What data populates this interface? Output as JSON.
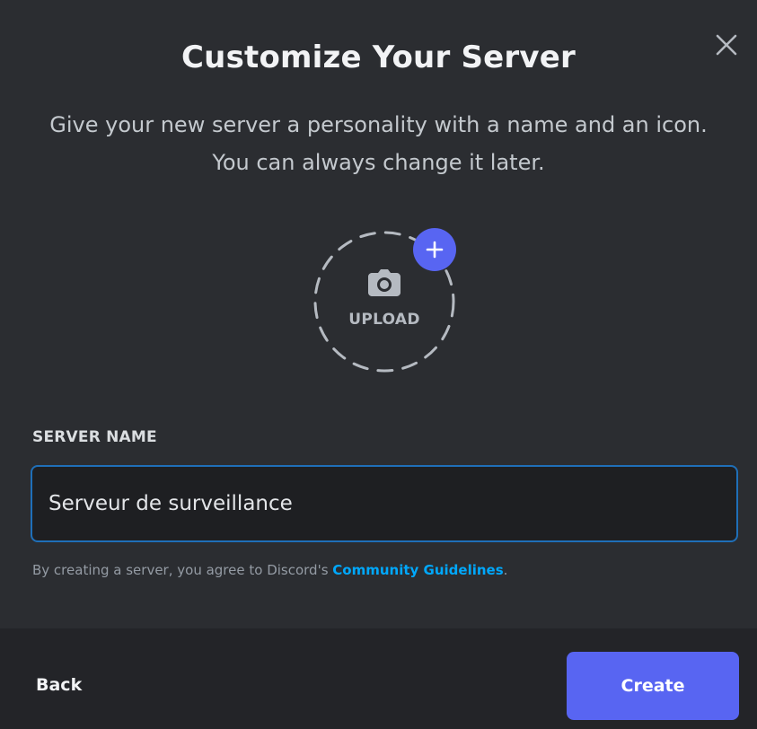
{
  "modal": {
    "title": "Customize Your Server",
    "subtitle": "Give your new server a personality with a name and an icon. You can always change it later.",
    "close_icon": "close-icon"
  },
  "upload": {
    "label": "UPLOAD",
    "camera_icon": "camera-icon",
    "plus_icon": "plus-icon"
  },
  "server_name": {
    "label": "SERVER NAME",
    "value": "Serveur de surveillance"
  },
  "agreement": {
    "prefix": "By creating a server, you agree to Discord's ",
    "link": "Community Guidelines",
    "suffix": "."
  },
  "footer": {
    "back_label": "Back",
    "create_label": "Create"
  },
  "colors": {
    "background": "#2b2d31",
    "footer_background": "#232428",
    "accent": "#5865f2",
    "link": "#00a8fc",
    "input_border": "#1f6fb8"
  }
}
